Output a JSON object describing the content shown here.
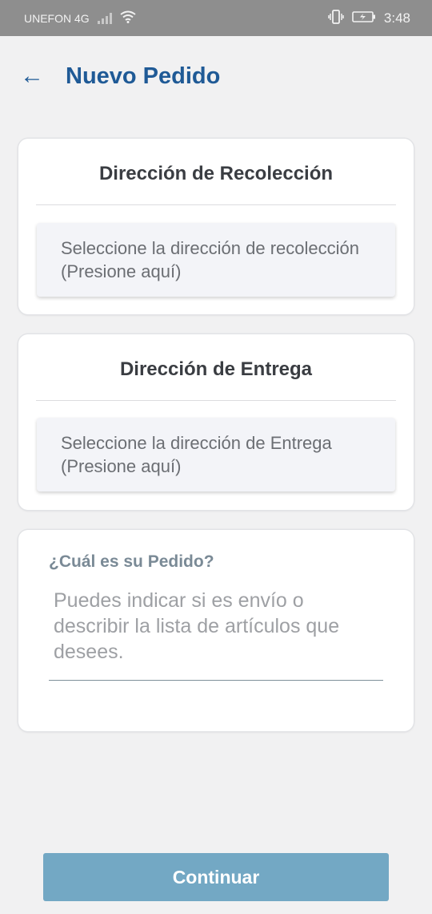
{
  "status_bar": {
    "carrier": "UNEFON 4G",
    "time": "3:48",
    "icons": [
      "signal-icon",
      "wifi-icon",
      "vibrate-icon",
      "battery-charging-icon"
    ]
  },
  "header": {
    "back_icon": "arrow-left-icon",
    "back_glyph": "←",
    "title": "Nuevo Pedido"
  },
  "pickup": {
    "title": "Dirección de Recolección",
    "prompt_line1": "Seleccione la dirección de recolección",
    "prompt_line2": "(Presione aquí)"
  },
  "delivery": {
    "title": "Dirección de Entrega",
    "prompt_line1": "Seleccione la dirección de Entrega",
    "prompt_line2": "(Presione aquí)"
  },
  "order": {
    "label": "¿Cuál es su Pedido?",
    "value": "",
    "placeholder": "Puedes indicar si es envío o describir la lista de artículos que desees."
  },
  "footer": {
    "continue_label": "Continuar"
  },
  "colors": {
    "primary": "#1f5a96",
    "button": "#73a8c4",
    "status_bar": "#8e8e8e",
    "background": "#f1f1f2"
  }
}
